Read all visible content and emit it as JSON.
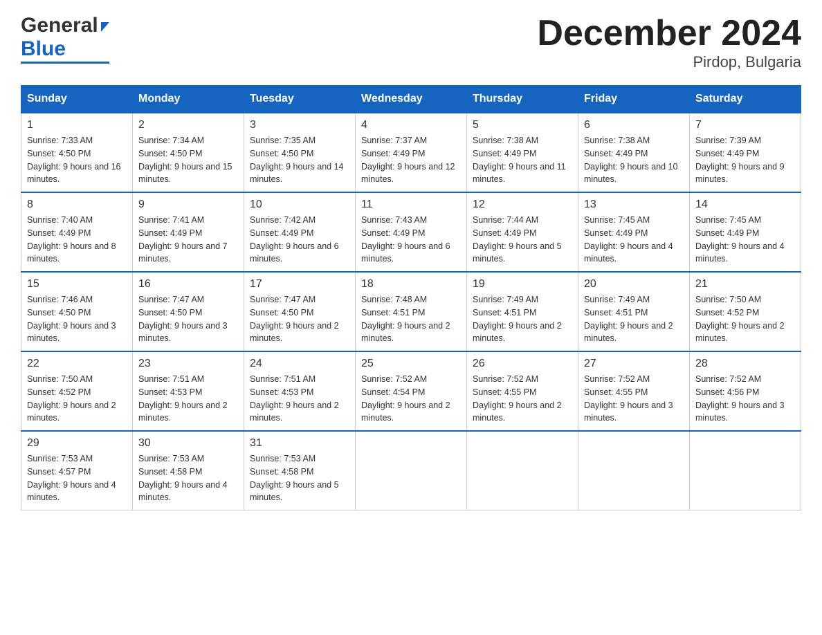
{
  "header": {
    "logo_general": "General",
    "logo_blue": "Blue",
    "month_title": "December 2024",
    "location": "Pirdop, Bulgaria"
  },
  "days_of_week": [
    "Sunday",
    "Monday",
    "Tuesday",
    "Wednesday",
    "Thursday",
    "Friday",
    "Saturday"
  ],
  "weeks": [
    [
      {
        "day": "1",
        "sunrise": "7:33 AM",
        "sunset": "4:50 PM",
        "daylight": "9 hours and 16 minutes."
      },
      {
        "day": "2",
        "sunrise": "7:34 AM",
        "sunset": "4:50 PM",
        "daylight": "9 hours and 15 minutes."
      },
      {
        "day": "3",
        "sunrise": "7:35 AM",
        "sunset": "4:50 PM",
        "daylight": "9 hours and 14 minutes."
      },
      {
        "day": "4",
        "sunrise": "7:37 AM",
        "sunset": "4:49 PM",
        "daylight": "9 hours and 12 minutes."
      },
      {
        "day": "5",
        "sunrise": "7:38 AM",
        "sunset": "4:49 PM",
        "daylight": "9 hours and 11 minutes."
      },
      {
        "day": "6",
        "sunrise": "7:38 AM",
        "sunset": "4:49 PM",
        "daylight": "9 hours and 10 minutes."
      },
      {
        "day": "7",
        "sunrise": "7:39 AM",
        "sunset": "4:49 PM",
        "daylight": "9 hours and 9 minutes."
      }
    ],
    [
      {
        "day": "8",
        "sunrise": "7:40 AM",
        "sunset": "4:49 PM",
        "daylight": "9 hours and 8 minutes."
      },
      {
        "day": "9",
        "sunrise": "7:41 AM",
        "sunset": "4:49 PM",
        "daylight": "9 hours and 7 minutes."
      },
      {
        "day": "10",
        "sunrise": "7:42 AM",
        "sunset": "4:49 PM",
        "daylight": "9 hours and 6 minutes."
      },
      {
        "day": "11",
        "sunrise": "7:43 AM",
        "sunset": "4:49 PM",
        "daylight": "9 hours and 6 minutes."
      },
      {
        "day": "12",
        "sunrise": "7:44 AM",
        "sunset": "4:49 PM",
        "daylight": "9 hours and 5 minutes."
      },
      {
        "day": "13",
        "sunrise": "7:45 AM",
        "sunset": "4:49 PM",
        "daylight": "9 hours and 4 minutes."
      },
      {
        "day": "14",
        "sunrise": "7:45 AM",
        "sunset": "4:49 PM",
        "daylight": "9 hours and 4 minutes."
      }
    ],
    [
      {
        "day": "15",
        "sunrise": "7:46 AM",
        "sunset": "4:50 PM",
        "daylight": "9 hours and 3 minutes."
      },
      {
        "day": "16",
        "sunrise": "7:47 AM",
        "sunset": "4:50 PM",
        "daylight": "9 hours and 3 minutes."
      },
      {
        "day": "17",
        "sunrise": "7:47 AM",
        "sunset": "4:50 PM",
        "daylight": "9 hours and 2 minutes."
      },
      {
        "day": "18",
        "sunrise": "7:48 AM",
        "sunset": "4:51 PM",
        "daylight": "9 hours and 2 minutes."
      },
      {
        "day": "19",
        "sunrise": "7:49 AM",
        "sunset": "4:51 PM",
        "daylight": "9 hours and 2 minutes."
      },
      {
        "day": "20",
        "sunrise": "7:49 AM",
        "sunset": "4:51 PM",
        "daylight": "9 hours and 2 minutes."
      },
      {
        "day": "21",
        "sunrise": "7:50 AM",
        "sunset": "4:52 PM",
        "daylight": "9 hours and 2 minutes."
      }
    ],
    [
      {
        "day": "22",
        "sunrise": "7:50 AM",
        "sunset": "4:52 PM",
        "daylight": "9 hours and 2 minutes."
      },
      {
        "day": "23",
        "sunrise": "7:51 AM",
        "sunset": "4:53 PM",
        "daylight": "9 hours and 2 minutes."
      },
      {
        "day": "24",
        "sunrise": "7:51 AM",
        "sunset": "4:53 PM",
        "daylight": "9 hours and 2 minutes."
      },
      {
        "day": "25",
        "sunrise": "7:52 AM",
        "sunset": "4:54 PM",
        "daylight": "9 hours and 2 minutes."
      },
      {
        "day": "26",
        "sunrise": "7:52 AM",
        "sunset": "4:55 PM",
        "daylight": "9 hours and 2 minutes."
      },
      {
        "day": "27",
        "sunrise": "7:52 AM",
        "sunset": "4:55 PM",
        "daylight": "9 hours and 3 minutes."
      },
      {
        "day": "28",
        "sunrise": "7:52 AM",
        "sunset": "4:56 PM",
        "daylight": "9 hours and 3 minutes."
      }
    ],
    [
      {
        "day": "29",
        "sunrise": "7:53 AM",
        "sunset": "4:57 PM",
        "daylight": "9 hours and 4 minutes."
      },
      {
        "day": "30",
        "sunrise": "7:53 AM",
        "sunset": "4:58 PM",
        "daylight": "9 hours and 4 minutes."
      },
      {
        "day": "31",
        "sunrise": "7:53 AM",
        "sunset": "4:58 PM",
        "daylight": "9 hours and 5 minutes."
      },
      null,
      null,
      null,
      null
    ]
  ]
}
